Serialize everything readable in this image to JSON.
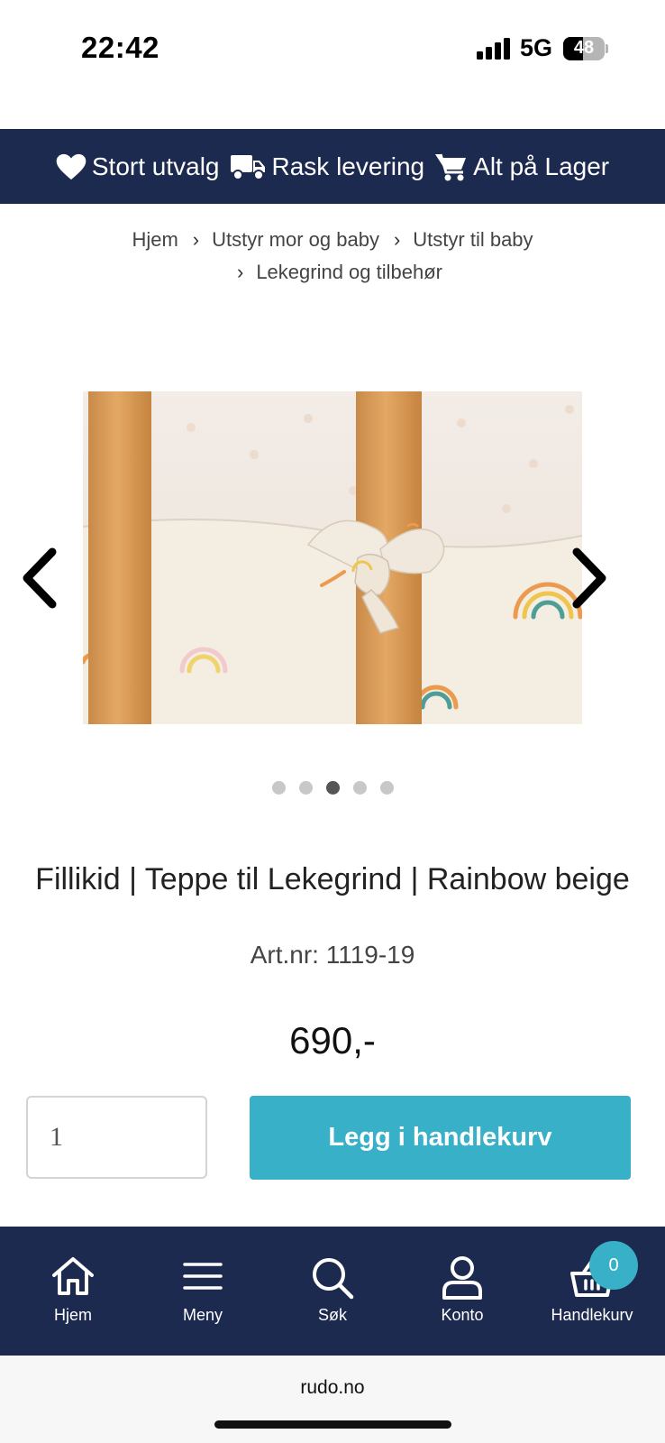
{
  "status_bar": {
    "time": "22:42",
    "network": "5G",
    "battery_level": "48"
  },
  "promo_bar": {
    "items": [
      {
        "icon": "heart-icon",
        "label": "Stort utvalg"
      },
      {
        "icon": "truck-icon",
        "label": "Rask levering"
      },
      {
        "icon": "cart-icon",
        "label": "Alt på Lager"
      }
    ]
  },
  "breadcrumb": {
    "items": [
      "Hjem",
      "Utstyr mor og baby",
      "Utstyr til baby",
      "Lekegrind og tilbehør"
    ],
    "separator": "›"
  },
  "gallery": {
    "image_count": 5,
    "active_index": 2,
    "prev_icon": "chevron-left-icon",
    "next_icon": "chevron-right-icon"
  },
  "product": {
    "title": "Fillikid | Teppe til Lekegrind | Rainbow beige",
    "artnr": "Art.nr: 1119-19",
    "price": "690,-",
    "quantity": "1",
    "add_to_cart_label": "Legg i handlekurv"
  },
  "bottom_nav": {
    "items": [
      {
        "icon": "home-icon",
        "label": "Hjem"
      },
      {
        "icon": "menu-icon",
        "label": "Meny"
      },
      {
        "icon": "search-icon",
        "label": "Søk"
      },
      {
        "icon": "user-icon",
        "label": "Konto"
      },
      {
        "icon": "basket-icon",
        "label": "Handlekurv"
      }
    ],
    "cart_count": "0"
  },
  "browser": {
    "url": "rudo.no"
  },
  "colors": {
    "navy": "#1d2a4f",
    "accent": "#37b0c8"
  }
}
